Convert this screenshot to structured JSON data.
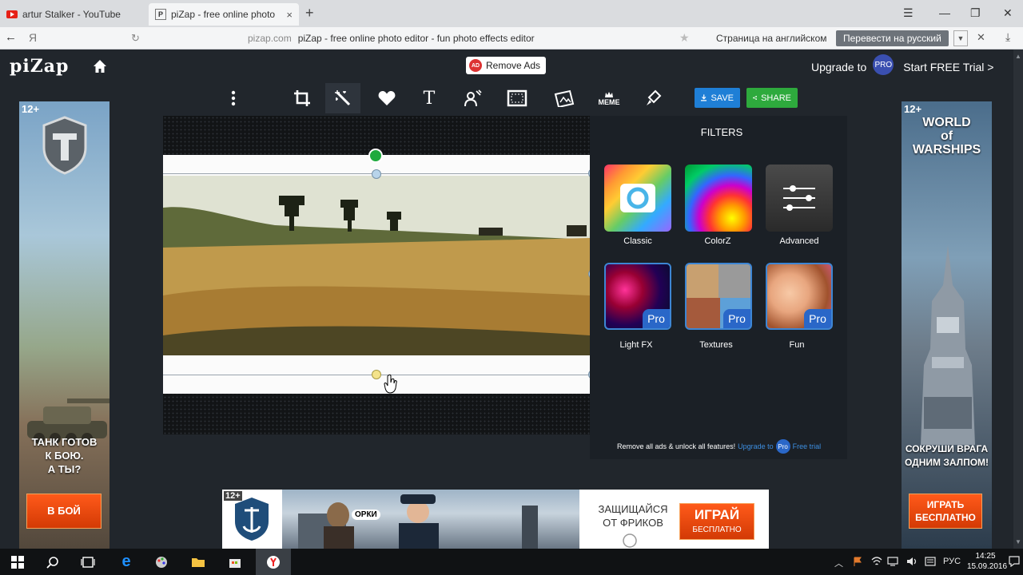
{
  "browser": {
    "tabs": [
      {
        "title": "artur Stalker - YouTube",
        "close": "×"
      },
      {
        "title": "piZap - free online photo",
        "favicon": "P",
        "close": "×"
      }
    ],
    "new_tab": "+",
    "window_controls": [
      "☰",
      "—",
      "❐",
      "✕"
    ],
    "back": "←",
    "ya": "Я",
    "reload": "↻",
    "domain": "pizap.com",
    "page_title": "piZap - free online photo editor - fun photo effects editor",
    "star": "★",
    "translate_question": "Страница на английском",
    "translate_button": "Перевести на русский",
    "translate_dropdown": "▼",
    "translate_close": "✕",
    "download": "⤓"
  },
  "app": {
    "logo": "piZap",
    "remove_ads": "Remove Ads",
    "remove_ads_badge": "AD",
    "upgrade_to": "Upgrade to",
    "pro": "PRO",
    "start_trial": "Start FREE Trial >"
  },
  "toolbar": {
    "tools": [
      {
        "name": "more-menu-icon",
        "active": false
      },
      {
        "name": "crop-icon",
        "active": false
      },
      {
        "name": "magic-wand-icon",
        "active": true
      },
      {
        "name": "heart-icon",
        "active": false
      },
      {
        "name": "text-icon",
        "active": false
      },
      {
        "name": "sticker-icon",
        "active": false
      },
      {
        "name": "frame-icon",
        "active": false
      },
      {
        "name": "collage-icon",
        "active": false
      },
      {
        "name": "meme-icon",
        "active": false
      },
      {
        "name": "paint-icon",
        "active": false
      }
    ],
    "text_tool_glyph": "T",
    "meme_label": "MEME",
    "save": "SAVE",
    "share": "SHARE"
  },
  "filters": {
    "title": "FILTERS",
    "items": [
      {
        "label": "Classic",
        "pro": false
      },
      {
        "label": "ColorZ",
        "pro": false
      },
      {
        "label": "Advanced",
        "pro": false
      },
      {
        "label": "Light FX",
        "pro": true
      },
      {
        "label": "Textures",
        "pro": true
      },
      {
        "label": "Fun",
        "pro": true
      }
    ],
    "pro_tag": "Pro",
    "promo_text": "Remove all ads & unlock all features!",
    "promo_upgrade": "Upgrade to",
    "promo_badge": "Pro",
    "promo_trial": "Free trial"
  },
  "ads": {
    "left": {
      "age": "12+",
      "text": "ТАНК ГОТОВ\nК БОЮ.\nА ТЫ?",
      "button": "В БОЙ"
    },
    "right": {
      "age": "12+",
      "logo": "WORLD\nof\nWARSHIPS",
      "text": "СОКРУШИ ВРАГА\nОДНИМ ЗАЛПОМ!",
      "button": "ИГРАТЬ\nБЕСПЛАТНО"
    },
    "bottom": {
      "age": "12+",
      "bubble": "ОРКИ",
      "slogan": "ЗАЩИЩАЙСЯ\nОТ ФРИКОВ",
      "button": "ИГРАЙ",
      "button_sub": "БЕСПЛАТНО"
    }
  },
  "taskbar": {
    "lang": "РУС",
    "time": "14:25",
    "date": "15.09.2016"
  }
}
